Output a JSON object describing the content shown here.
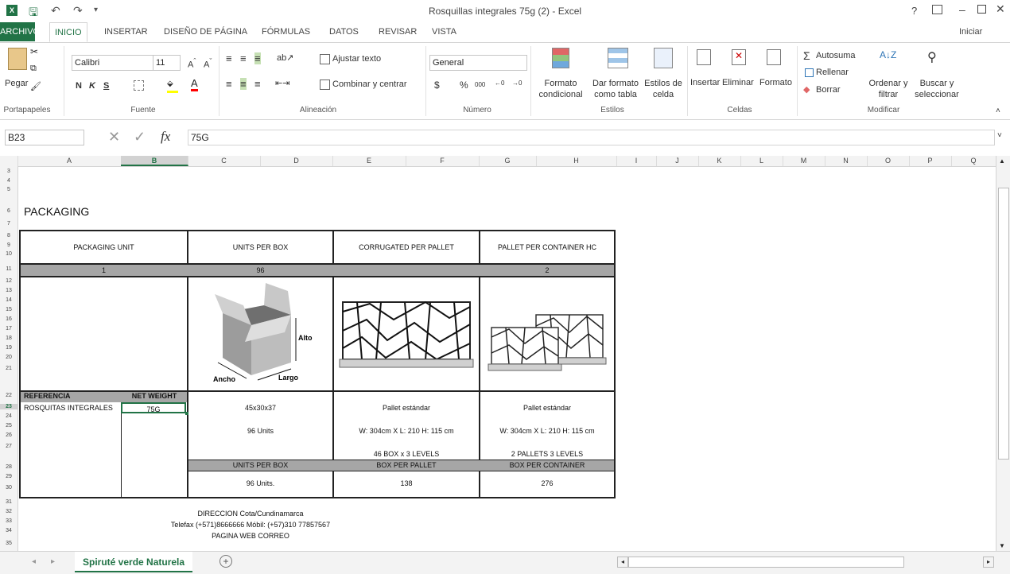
{
  "window": {
    "title": "Rosquillas integrales 75g (2) - Excel",
    "help": "?",
    "signin": "Iniciar sesión"
  },
  "tabs": [
    "ARCHIVO",
    "INICIO",
    "INSERTAR",
    "DISEÑO DE PÁGINA",
    "FÓRMULAS",
    "DATOS",
    "REVISAR",
    "VISTA"
  ],
  "ribbon": {
    "clipboard": {
      "paste": "Pegar",
      "label": "Portapapeles"
    },
    "font": {
      "name": "Calibri",
      "size": "11",
      "bold": "N",
      "italic": "K",
      "underline": "S",
      "label": "Fuente"
    },
    "alignment": {
      "wrap": "Ajustar texto",
      "merge": "Combinar y centrar",
      "label": "Alineación"
    },
    "number": {
      "format": "General",
      "currency": "$",
      "percent": "%",
      "thousands": "000",
      "label": "Número"
    },
    "styles": {
      "conditional": "Formato condicional",
      "table": "Dar formato como tabla",
      "cell": "Estilos de celda",
      "label": "Estilos"
    },
    "cells": {
      "insert": "Insertar",
      "delete": "Eliminar",
      "format": "Formato",
      "label": "Celdas"
    },
    "edit": {
      "autosum": "Autosuma",
      "fill": "Rellenar",
      "clear": "Borrar",
      "sort": "Ordenar y filtrar",
      "find": "Buscar y seleccionar",
      "label": "Modificar"
    }
  },
  "formula_bar": {
    "name_box": "B23",
    "fx": "fx",
    "value": "75G"
  },
  "columns": [
    "A",
    "B",
    "C",
    "D",
    "E",
    "F",
    "G",
    "H",
    "I",
    "J",
    "K",
    "L",
    "M",
    "N",
    "O",
    "P",
    "Q"
  ],
  "rows": [
    "3",
    "4",
    "5",
    "6",
    "7",
    "8",
    "9",
    "10",
    "11",
    "12",
    "13",
    "14",
    "15",
    "16",
    "17",
    "18",
    "19",
    "20",
    "21",
    "22",
    "23",
    "24",
    "25",
    "26",
    "27",
    "28",
    "29",
    "30",
    "31",
    "32",
    "33",
    "34",
    "35"
  ],
  "sheet": {
    "title": "PACKAGING",
    "headers": [
      "PACKAGING UNIT",
      "UNITS PER BOX",
      "CORRUGATED PER PALLET",
      "PALLET PER CONTAINER HC"
    ],
    "header_values": [
      "1",
      "96",
      "",
      "2"
    ],
    "box_labels": {
      "alto": "Alto",
      "ancho": "Ancho",
      "largo": "Largo"
    },
    "ref_header": "REFERENCIA",
    "weight_header": "NET WEIGHT",
    "ref_value": "ROSQUITAS INTEGRALES",
    "weight_value": "75G",
    "dims": "45x30x37",
    "units": "96 Units",
    "pallet1": "Pallet estándar",
    "pallet1_dims": "W: 304cm X L: 210 H: 115 cm",
    "pallet1_levels": "46 BOX x 3 LEVELS",
    "pallet2": "Pallet estándar",
    "pallet2_dims": "W: 304cm X L: 210 H: 115 cm",
    "pallet2_levels": "2 PALLETS 3 LEVELS",
    "sub_headers": [
      "UNITS PER BOX",
      "BOX PER PALLET",
      "BOX PER CONTAINER"
    ],
    "sub_values": [
      "96 Units.",
      "138",
      "276"
    ],
    "footer": [
      "DIRECCION Cota/Cundinamarca",
      "Telefax (+571)8666666 Móbil: (+57)310 77857567",
      "PAGINA WEB CORREO"
    ]
  },
  "sheet_tab": "Spiruté verde Naturela",
  "colors": {
    "excel_green": "#217346",
    "header_gray": "#a6a6a6"
  }
}
